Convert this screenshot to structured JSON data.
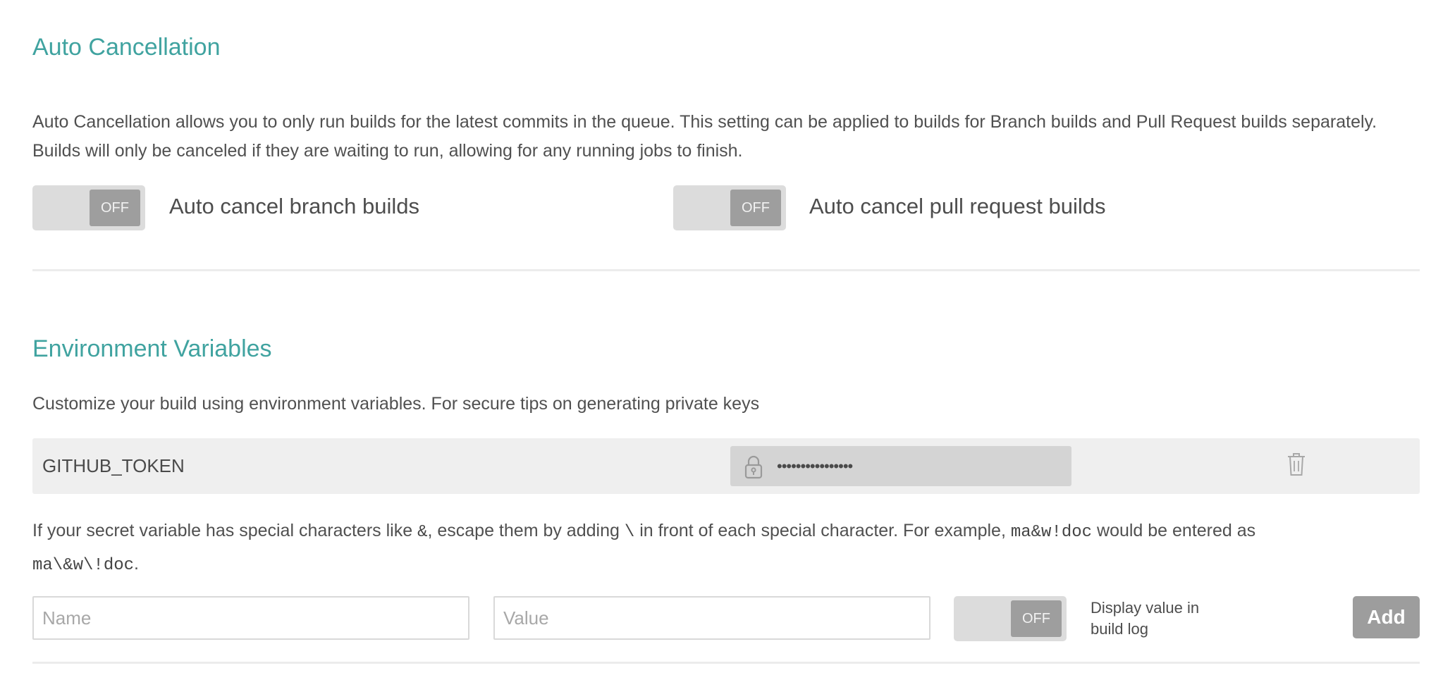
{
  "auto_cancellation": {
    "title": "Auto Cancellation",
    "description": "Auto Cancellation allows you to only run builds for the latest commits in the queue. This setting can be applied to builds for Branch builds and Pull Request builds separately. Builds will only be canceled if they are waiting to run, allowing for any running jobs to finish.",
    "branch_toggle": {
      "state": "OFF",
      "label": "Auto cancel branch builds"
    },
    "pr_toggle": {
      "state": "OFF",
      "label": "Auto cancel pull request builds"
    }
  },
  "environment_variables": {
    "title": "Environment Variables",
    "description": "Customize your build using environment variables. For secure tips on generating private keys",
    "variables": [
      {
        "name": "GITHUB_TOKEN",
        "masked_value": "••••••••••••••••",
        "icon": "lock-icon"
      }
    ],
    "delete_icon": "trash-icon",
    "secret_note": {
      "part1": "If your secret variable has special characters like ",
      "code_amp": "&",
      "part2": ", escape them by adding ",
      "code_backslash": "\\",
      "part3": " in front of each special character. For example, ",
      "code_example": "ma&w!doc",
      "part4": " would be entered as ",
      "code_escaped": "ma\\&w\\!doc",
      "part5": "."
    },
    "new_variable": {
      "name_placeholder": "Name",
      "value_placeholder": "Value",
      "display_toggle_state": "OFF",
      "display_label": "Display value in build log",
      "add_label": "Add"
    }
  },
  "colors": {
    "heading": "#40a3a0",
    "toggle_track": "#dcdcdc",
    "toggle_knob": "#9e9e9e",
    "add_button": "#9d9d9d",
    "row_background": "#efefef"
  }
}
